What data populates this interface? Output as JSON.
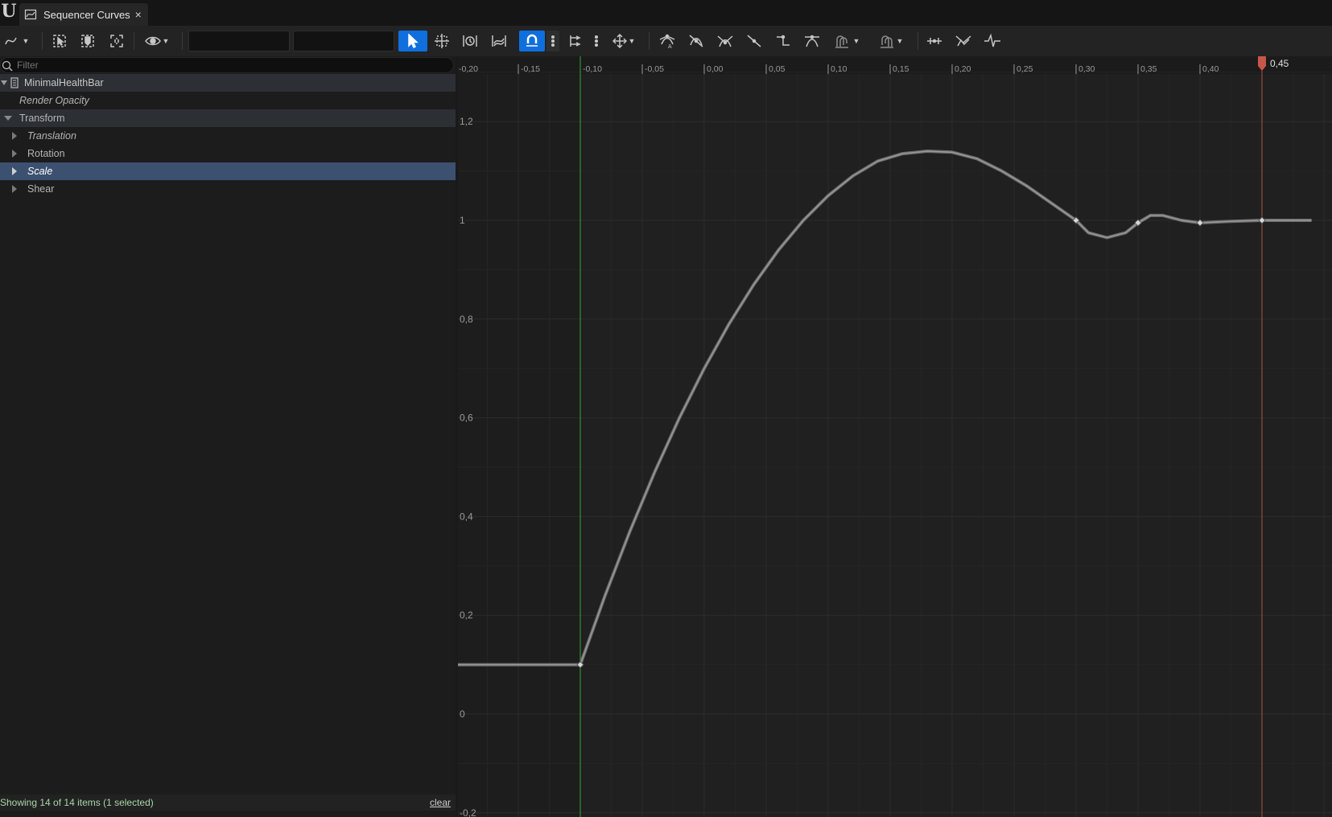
{
  "window": {
    "tab_title": "Sequencer Curves",
    "close_glyph": "×"
  },
  "toolbar": {
    "buttons": [
      {
        "name": "curve-view-mode-icon"
      },
      {
        "name": "select-all-keys-icon"
      },
      {
        "name": "select-key-icon"
      },
      {
        "name": "frame-selection-icon"
      },
      {
        "name": "visibility-eye-icon"
      },
      {
        "name": "select-tool-icon",
        "active": true
      },
      {
        "name": "transform-tool-icon"
      },
      {
        "name": "retime-tool-icon"
      },
      {
        "name": "multi-scale-tool-icon"
      },
      {
        "name": "snap-magnet-icon",
        "active": true
      },
      {
        "name": "tangent-align-icon"
      },
      {
        "name": "move-axis-icon"
      },
      {
        "name": "auto-tangent-icon"
      },
      {
        "name": "user-tangent-icon"
      },
      {
        "name": "break-tangent-icon"
      },
      {
        "name": "linear-tangent-icon"
      },
      {
        "name": "constant-tangent-icon"
      },
      {
        "name": "flatten-tangent-icon"
      },
      {
        "name": "pre-infinity-icon"
      },
      {
        "name": "post-infinity-icon"
      },
      {
        "name": "straighten-tangent-icon"
      },
      {
        "name": "bake-curve-icon"
      },
      {
        "name": "reduce-curve-icon"
      }
    ],
    "time_input": "",
    "value_input": ""
  },
  "outliner": {
    "filter_placeholder": "Filter",
    "items": [
      {
        "label": "MinimalHealthBar"
      },
      {
        "label": "Render Opacity"
      },
      {
        "label": "Transform"
      },
      {
        "label": "Translation"
      },
      {
        "label": "Rotation"
      },
      {
        "label": "Scale"
      },
      {
        "label": "Shear"
      }
    ],
    "status": "Showing 14 of 14 items (1 selected)",
    "clear_label": "clear"
  },
  "colors": {
    "accent": "#0f6fde",
    "selection": "#3c5170",
    "playhead": "#c8564a",
    "start_marker": "#33aa33",
    "curve": "#9a9a9a"
  },
  "chart_data": {
    "type": "line",
    "x_ticks": [
      "-0,20",
      "-0,15",
      "-0,10",
      "-0,05",
      "0,00",
      "0,05",
      "0,10",
      "0,15",
      "0,20",
      "0,25",
      "0,30",
      "0,35",
      "0,40"
    ],
    "y_ticks": [
      "1,2",
      "1",
      "0,8",
      "0,6",
      "0,4",
      "0,2",
      "0",
      "-0,2"
    ],
    "xlim": [
      -0.2,
      0.49
    ],
    "ylim": [
      -0.2,
      1.2
    ],
    "playhead_time": 0.45,
    "playhead_label": "0,45",
    "start_marker_time": -0.1,
    "series": [
      {
        "keys": [
          [
            -0.1,
            0.1
          ],
          [
            0.3,
            1.0
          ],
          [
            0.35,
            0.995
          ],
          [
            0.4,
            0.995
          ],
          [
            0.45,
            1.0
          ]
        ],
        "curve": [
          [
            -0.2,
            0.1
          ],
          [
            -0.1,
            0.1
          ],
          [
            -0.08,
            0.24
          ],
          [
            -0.06,
            0.37
          ],
          [
            -0.04,
            0.49
          ],
          [
            -0.02,
            0.6
          ],
          [
            0.0,
            0.7
          ],
          [
            0.02,
            0.79
          ],
          [
            0.04,
            0.87
          ],
          [
            0.06,
            0.94
          ],
          [
            0.08,
            1.0
          ],
          [
            0.1,
            1.05
          ],
          [
            0.12,
            1.09
          ],
          [
            0.14,
            1.12
          ],
          [
            0.16,
            1.135
          ],
          [
            0.18,
            1.14
          ],
          [
            0.2,
            1.138
          ],
          [
            0.22,
            1.125
          ],
          [
            0.24,
            1.1
          ],
          [
            0.26,
            1.07
          ],
          [
            0.28,
            1.035
          ],
          [
            0.3,
            1.0
          ],
          [
            0.31,
            0.975
          ],
          [
            0.325,
            0.965
          ],
          [
            0.34,
            0.975
          ],
          [
            0.35,
            0.995
          ],
          [
            0.36,
            1.01
          ],
          [
            0.37,
            1.01
          ],
          [
            0.385,
            1.0
          ],
          [
            0.4,
            0.995
          ],
          [
            0.425,
            0.998
          ],
          [
            0.45,
            1.0
          ],
          [
            0.49,
            1.0
          ]
        ]
      }
    ]
  }
}
